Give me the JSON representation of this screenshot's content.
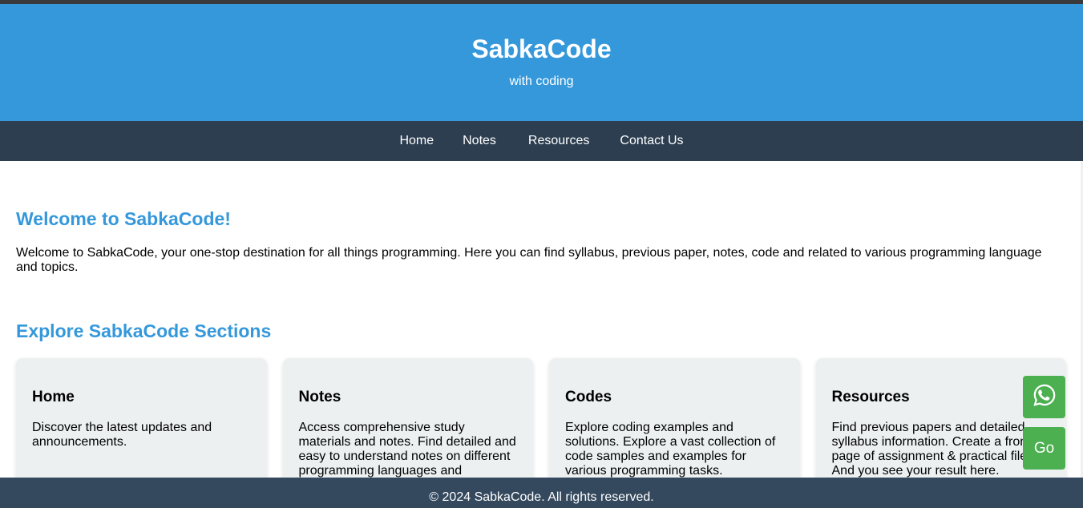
{
  "header": {
    "title": "SabkaCode",
    "tagline": "with coding"
  },
  "nav": {
    "items": [
      "Home",
      "Notes",
      "Resources",
      "Contact Us"
    ]
  },
  "welcome": {
    "title": "Welcome to SabkaCode!",
    "text": "Welcome to SabkaCode, your one-stop destination for all things programming. Here you can find syllabus, previous paper, notes, code and related to various programming language and topics."
  },
  "explore": {
    "title": "Explore SabkaCode Sections",
    "cards": [
      {
        "title": "Home",
        "text": "Discover the latest updates and announcements."
      },
      {
        "title": "Notes",
        "text": "Access comprehensive study materials and notes. Find detailed and easy to understand notes on different programming languages and"
      },
      {
        "title": "Codes",
        "text": "Explore coding examples and solutions. Explore a vast collection of code samples and examples for various programming tasks."
      },
      {
        "title": "Resources",
        "text": "Find previous papers and detailed syllabus information. Create a front page of assignment & practical file. And you see your result here."
      }
    ]
  },
  "floating": {
    "whatsapp_icon": "whatsapp-icon",
    "go_label": "Go",
    "color": "#4caf50"
  },
  "footer": {
    "text": "© 2024 SabkaCode. All rights reserved."
  },
  "colors": {
    "header": "#3498db",
    "nav": "#2c3e50",
    "footer": "#34495e",
    "card": "#ecf0f1"
  }
}
